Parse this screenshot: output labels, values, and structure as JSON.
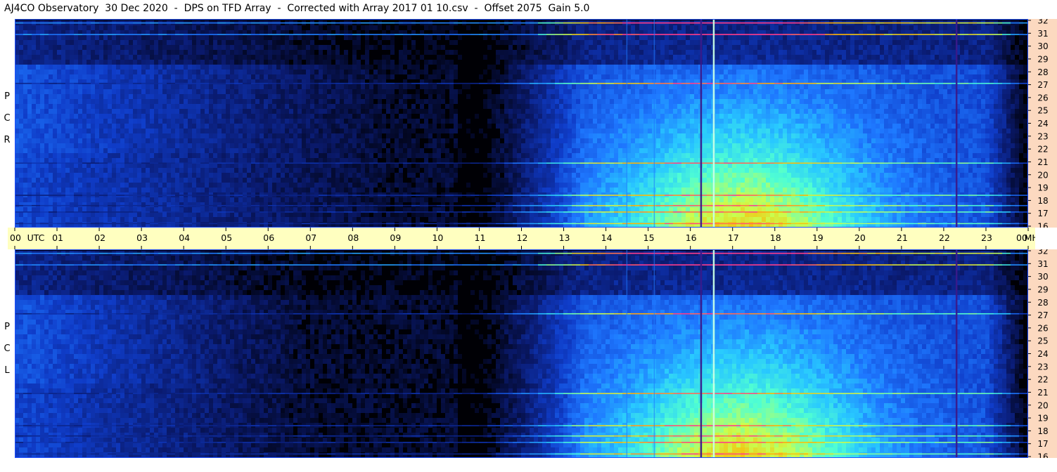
{
  "title": "AJ4CO Observatory  30 Dec 2020  -  DPS on TFD Array  -  Corrected with Array 2017 01 10.csv  -  Offset 2075  Gain 5.0",
  "chart_data": {
    "type": "heatmap",
    "title": "AJ4CO Observatory  30 Dec 2020  -  DPS on TFD Array  -  Corrected with Array 2017 01 10.csv  -  Offset 2075  Gain 5.0",
    "x_axis": {
      "unit_label": "UTC",
      "range": [
        0,
        24
      ],
      "tick_labels": [
        "00",
        "01",
        "02",
        "03",
        "04",
        "05",
        "06",
        "07",
        "08",
        "09",
        "10",
        "11",
        "12",
        "13",
        "14",
        "15",
        "16",
        "17",
        "18",
        "19",
        "20",
        "21",
        "22",
        "23",
        "00"
      ]
    },
    "y_axis": {
      "unit_label": "MHz",
      "range": [
        16,
        32
      ],
      "tick_labels": [
        "32",
        "31",
        "30",
        "29",
        "28",
        "27",
        "26",
        "25",
        "24",
        "23",
        "22",
        "21",
        "20",
        "19",
        "18",
        "17",
        "16"
      ]
    },
    "panels": [
      {
        "name": "R C P",
        "letters": [
          "R",
          "C",
          "P"
        ]
      },
      {
        "name": "L C P",
        "letters": [
          "L",
          "C",
          "P"
        ]
      }
    ],
    "colormap": [
      "#000008",
      "#0a1a6e",
      "#0f3cc8",
      "#1e78ff",
      "#28c8ff",
      "#50ffd2",
      "#c8ff50",
      "#ffb400",
      "#ff3c8c"
    ],
    "noise_floor_utc": {
      "low_until": 11.0,
      "rise_start": 11.0,
      "full_from": 13.5,
      "fade_after": 23.0
    },
    "persistent_carriers_mhz": [
      31.8,
      30.9,
      27.1,
      20.9,
      18.4,
      17.6,
      17.1,
      16.2
    ],
    "vertical_interference_utc": [
      14.5,
      15.15,
      16.25,
      16.55,
      22.3
    ]
  }
}
